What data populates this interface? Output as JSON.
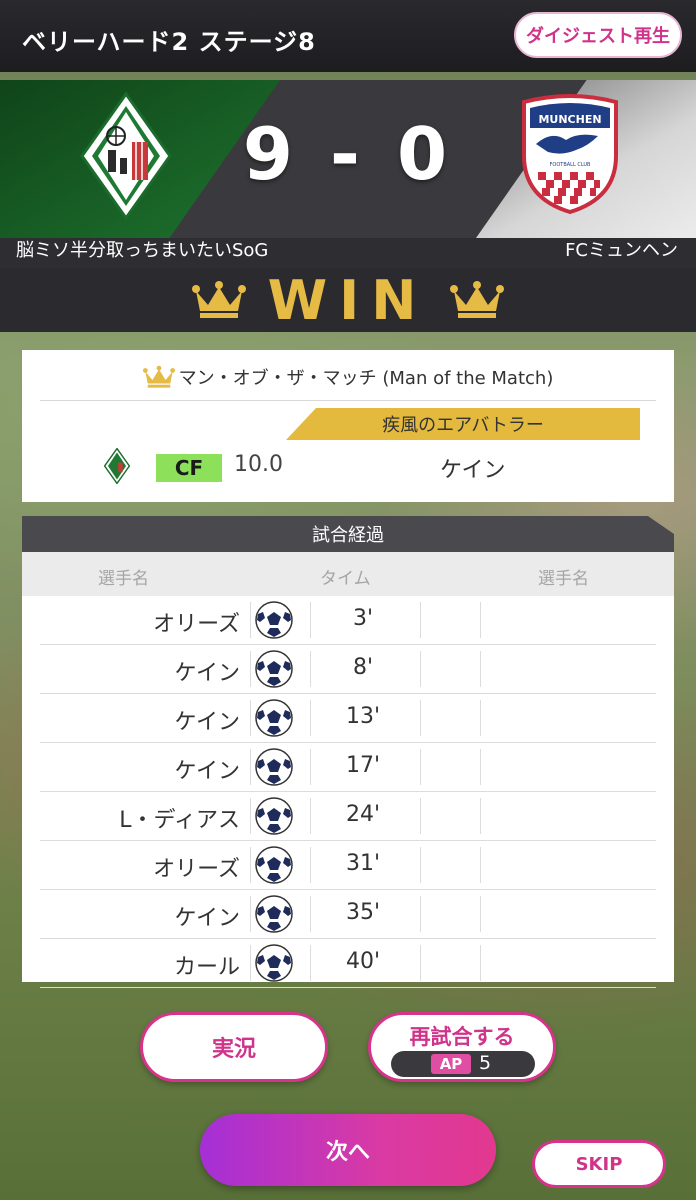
{
  "header": {
    "title": "ベリーハード2 ステージ8",
    "digest_label": "ダイジェスト再生"
  },
  "match": {
    "score": "9 - 0",
    "home_team": "脳ミソ半分取っちまいたいSoG",
    "away_team": "FCミュンヘン",
    "away_emblem_text": "MUNCHEN",
    "away_emblem_sub": "FOOTBALL CLUB",
    "result": "WIN"
  },
  "mom": {
    "title": "マン・オブ・ザ・マッチ (Man of the Match)",
    "skill": "疾風のエアバトラー",
    "position": "CF",
    "rating": "10.0",
    "player": "ケイン"
  },
  "timeline": {
    "title": "試合経過",
    "col_left": "選手名",
    "col_mid": "タイム",
    "col_right": "選手名",
    "goals": [
      {
        "player": "オリーズ",
        "time": "3'"
      },
      {
        "player": "ケイン",
        "time": "8'"
      },
      {
        "player": "ケイン",
        "time": "13'"
      },
      {
        "player": "ケイン",
        "time": "17'"
      },
      {
        "player": "L・ディアス",
        "time": "24'"
      },
      {
        "player": "オリーズ",
        "time": "31'"
      },
      {
        "player": "ケイン",
        "time": "35'"
      },
      {
        "player": "カール",
        "time": "40'"
      }
    ]
  },
  "actions": {
    "live_label": "実況",
    "rematch_label": "再試合する",
    "ap_label": "AP",
    "ap_cost": "5",
    "next_label": "次へ",
    "skip_label": "SKIP"
  },
  "colors": {
    "accent": "#d0338a",
    "gold": "#e6bb45",
    "cf_badge": "#8de05a"
  },
  "icons": [
    "crown-icon",
    "soccer-ball-icon",
    "home-team-emblem",
    "away-team-emblem"
  ]
}
